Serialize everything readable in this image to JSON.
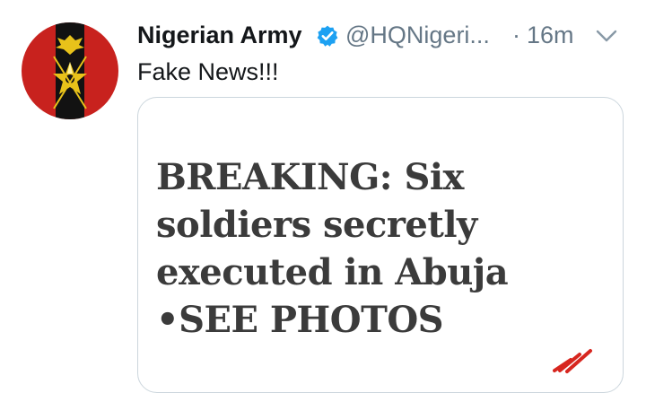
{
  "tweet": {
    "author_name": "Nigerian Army",
    "handle": "@HQNigeri...",
    "separator": "·",
    "time": "16m",
    "text": "Fake News!!!",
    "verified": true
  },
  "card": {
    "headline": "BREAKING: Six soldiers secretly executed in Abuja •SEE PHOTOS"
  },
  "icons": {
    "verified": "verified-badge-icon",
    "caret": "chevron-down-icon"
  },
  "colors": {
    "verified_blue": "#1da1f2",
    "avatar_red": "#c8221e",
    "avatar_black": "#121212",
    "avatar_gold": "#e8c21a"
  }
}
